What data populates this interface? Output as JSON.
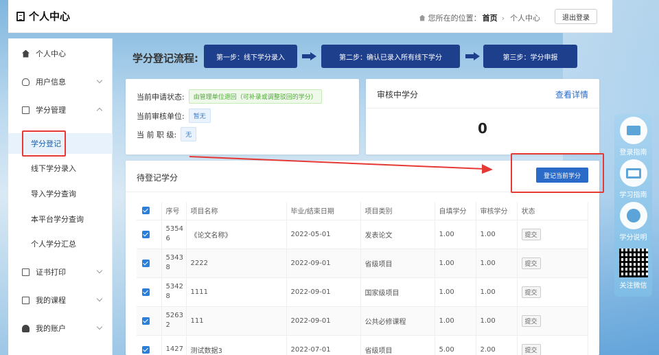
{
  "header": {
    "title": "个人中心",
    "location_prefix": "您所在的位置：",
    "location_home": "首页",
    "location_current": "个人中心",
    "logout_label": "退出登录"
  },
  "sidebar": {
    "items": [
      {
        "label": "个人中心",
        "icon": "home-icon"
      },
      {
        "label": "用户信息",
        "icon": "user-icon"
      },
      {
        "label": "学分管理",
        "icon": "book-icon"
      },
      {
        "label": "证书打印",
        "icon": "print-icon"
      },
      {
        "label": "我的课程",
        "icon": "course-icon"
      },
      {
        "label": "我的账户",
        "icon": "account-icon"
      }
    ],
    "sub_items": [
      "学分登记",
      "线下学分录入",
      "导入学分查询",
      "本平台学分查询",
      "个人学分汇总"
    ]
  },
  "flow": {
    "title": "学分登记流程:",
    "steps": [
      "第一步：线下学分录入",
      "第二步：确认已录入所有线下学分",
      "第三步：学分申报"
    ]
  },
  "status": {
    "apply_state_label": "当前申请状态:",
    "apply_state_value": "由管理单位退回（可补录或调整驳回的学分）",
    "review_unit_label": "当前审核单位:",
    "review_unit_value": "暂无",
    "title_label": "当 前 职 级:",
    "title_value": "无"
  },
  "review": {
    "title": "审核中学分",
    "link": "查看详情",
    "value": "0"
  },
  "pending": {
    "title": "待登记学分",
    "button": "登记当前学分"
  },
  "table": {
    "headers": [
      "序号",
      "项目名称",
      "毕业/结束日期",
      "项目类别",
      "自填学分",
      "审核学分",
      "状态"
    ],
    "rows": [
      {
        "id1": "5354",
        "id2": "6",
        "name": "《论文名称》",
        "date": "2022-05-01",
        "type": "发表论文",
        "self": "1.00",
        "audit": "1.00",
        "status": "提交"
      },
      {
        "id1": "5343",
        "id2": "8",
        "name": "2222",
        "date": "2022-09-01",
        "type": "省级项目",
        "self": "1.00",
        "audit": "1.00",
        "status": "提交"
      },
      {
        "id1": "5342",
        "id2": "8",
        "name": "1111",
        "date": "2022-09-01",
        "type": "国家级项目",
        "self": "1.00",
        "audit": "1.00",
        "status": "提交"
      },
      {
        "id1": "5263",
        "id2": "2",
        "name": "111",
        "date": "2022-09-01",
        "type": "公共必修课程",
        "self": "1.00",
        "audit": "1.00",
        "status": "提交"
      },
      {
        "id1": "1427",
        "id2": "",
        "name": "测试数据3",
        "date": "2022-07-01",
        "type": "省级项目",
        "self": "5.00",
        "audit": "2.00",
        "status": "提交"
      }
    ]
  },
  "right_float": [
    "登录指南",
    "学习指南",
    "学分说明",
    "关注微信"
  ],
  "colors": {
    "primary": "#1e3f8c",
    "accent": "#2a6bc9",
    "highlight": "#e53935"
  }
}
